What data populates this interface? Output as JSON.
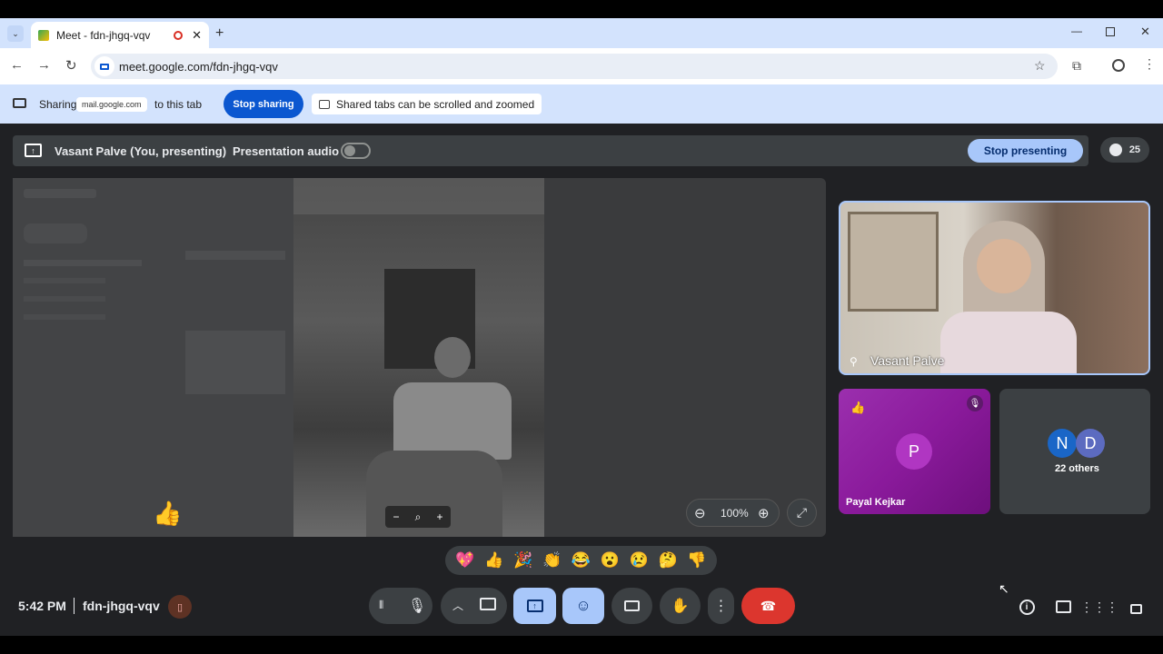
{
  "browser": {
    "tab_title": "Meet - fdn-jhgq-vqv",
    "url": "meet.google.com/fdn-jhgq-vqv"
  },
  "sharebar": {
    "sharing_label": "Sharing",
    "shared_site": "mail.google.com",
    "to_this_tab": "to this tab",
    "stop_sharing": "Stop sharing",
    "info": "Shared tabs can be scrolled and zoomed"
  },
  "presenting": {
    "presenter_label": "Vasant Palve (You, presenting)",
    "audio_label": "Presentation audio",
    "stop_presenting": "Stop presenting",
    "participant_count": "25"
  },
  "zoom": {
    "level": "100%"
  },
  "tiles": {
    "main_name": "Vasant Palve",
    "payal_name": "Payal Kejkar",
    "payal_initial": "P",
    "others_initials": [
      "N",
      "D"
    ],
    "others_label": "22 others"
  },
  "reactions": [
    "💖",
    "👍",
    "🎉",
    "👏",
    "😂",
    "😮",
    "😢",
    "🤔",
    "👎"
  ],
  "footer": {
    "time": "5:42 PM",
    "meeting_code": "fdn-jhgq-vqv"
  },
  "colors": {
    "accent_blue": "#0b57d0",
    "light_blue": "#a8c7fa",
    "end_call_red": "#dc362e",
    "payal_tile": "#8a1a9b"
  }
}
